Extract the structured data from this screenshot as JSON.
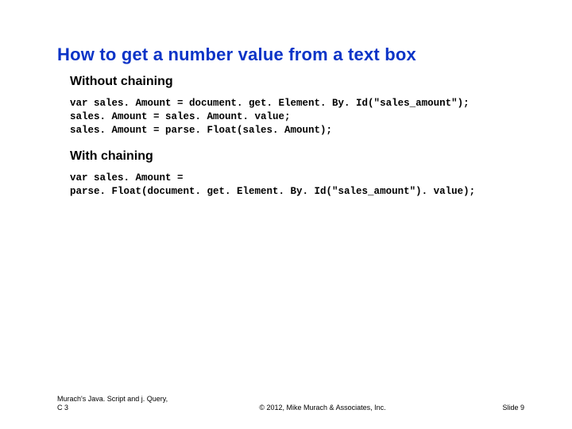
{
  "title": "How to get a number value from a text box",
  "section1": {
    "heading": "Without chaining",
    "code": "var sales. Amount = document. get. Element. By. Id(\"sales_amount\");\nsales. Amount = sales. Amount. value;\nsales. Amount = parse. Float(sales. Amount);"
  },
  "section2": {
    "heading": "With chaining",
    "code": "var sales. Amount =\nparse. Float(document. get. Element. By. Id(\"sales_amount\"). value);"
  },
  "footer": {
    "left_line1": "Murach's Java. Script and j. Query,",
    "left_line2": "C 3",
    "center": "© 2012, Mike Murach & Associates, Inc.",
    "right": "Slide 9"
  }
}
